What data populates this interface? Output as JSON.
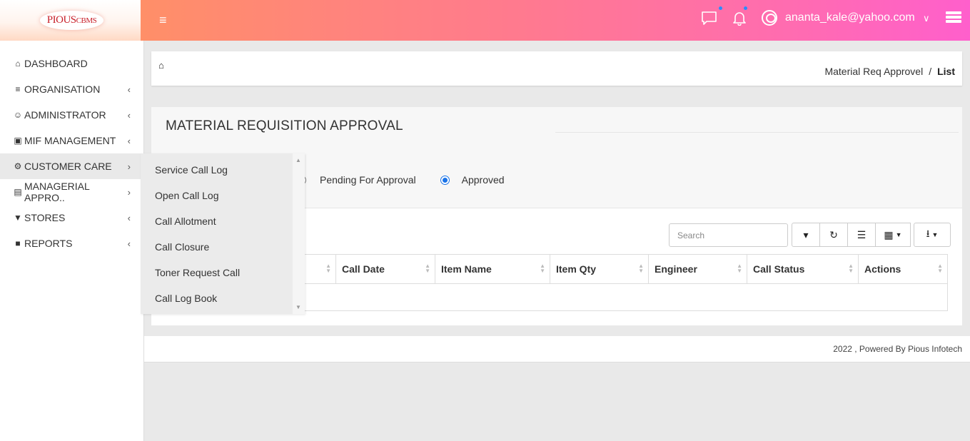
{
  "logo": {
    "text_main": "PIOUS",
    "text_small": "CBMS"
  },
  "sidebar": {
    "items": [
      {
        "label": "DASHBOARD",
        "icon": "home-icon",
        "glyph": "⌂",
        "has_children": false
      },
      {
        "label": "ORGANISATION",
        "icon": "database-icon",
        "glyph": "≡",
        "has_children": true
      },
      {
        "label": "ADMINISTRATOR",
        "icon": "users-icon",
        "glyph": "☺",
        "has_children": true
      },
      {
        "label": "MIF MANAGEMENT",
        "icon": "cubes-icon",
        "glyph": "▣",
        "has_children": true
      },
      {
        "label": "CUSTOMER CARE",
        "icon": "gear-icon",
        "glyph": "⚙",
        "has_children": true,
        "active": true
      },
      {
        "label": "MANAGERIAL APPRO..",
        "icon": "id-card-icon",
        "glyph": "▤",
        "has_children": true
      },
      {
        "label": "STORES",
        "icon": "cart-icon",
        "glyph": "▼",
        "has_children": true
      },
      {
        "label": "REPORTS",
        "icon": "file-icon",
        "glyph": "■",
        "has_children": true
      }
    ],
    "chevron_left": "‹",
    "chevron_right": "›"
  },
  "header": {
    "hamburger": "≡",
    "user_email": "ananta_kale@yahoo.com",
    "user_chevron": "∨"
  },
  "breadcrumb": {
    "home_glyph": "⌂",
    "parent": "Material Req Approvel",
    "separator": "/",
    "current": "List"
  },
  "panel": {
    "title": "MATERIAL REQUISITION APPROVAL",
    "radios": [
      {
        "label": "Pending For Approval",
        "checked": false
      },
      {
        "label": "Approved",
        "checked": true
      }
    ]
  },
  "table": {
    "search_placeholder": "Search",
    "toolbar_buttons": [
      {
        "name": "toggle-pagination-button",
        "icon": "archive-icon",
        "glyph": "▾"
      },
      {
        "name": "refresh-button",
        "icon": "refresh-icon",
        "glyph": "↻"
      },
      {
        "name": "toggle-view-button",
        "icon": "list-icon",
        "glyph": "☰"
      },
      {
        "name": "columns-button",
        "icon": "grid-icon",
        "glyph": "▦"
      },
      {
        "name": "export-button",
        "icon": "download-icon",
        "glyph": "⭳"
      }
    ],
    "columns": [
      "Call Date",
      "Item Name",
      "Item Qty",
      "Engineer",
      "Call Status",
      "Actions"
    ]
  },
  "flyout": {
    "items": [
      "Service Call Log",
      "Open Call Log",
      "Call Allotment",
      "Call Closure",
      "Toner Request Call",
      "Call Log Book"
    ]
  },
  "footer": {
    "text": "2022 , Powered By Pious Infotech"
  },
  "colors": {
    "header_start": "#ff8f68",
    "header_end": "#ff5fcc",
    "radio_accent": "#1a73e8",
    "logo_red": "#c8202a"
  }
}
